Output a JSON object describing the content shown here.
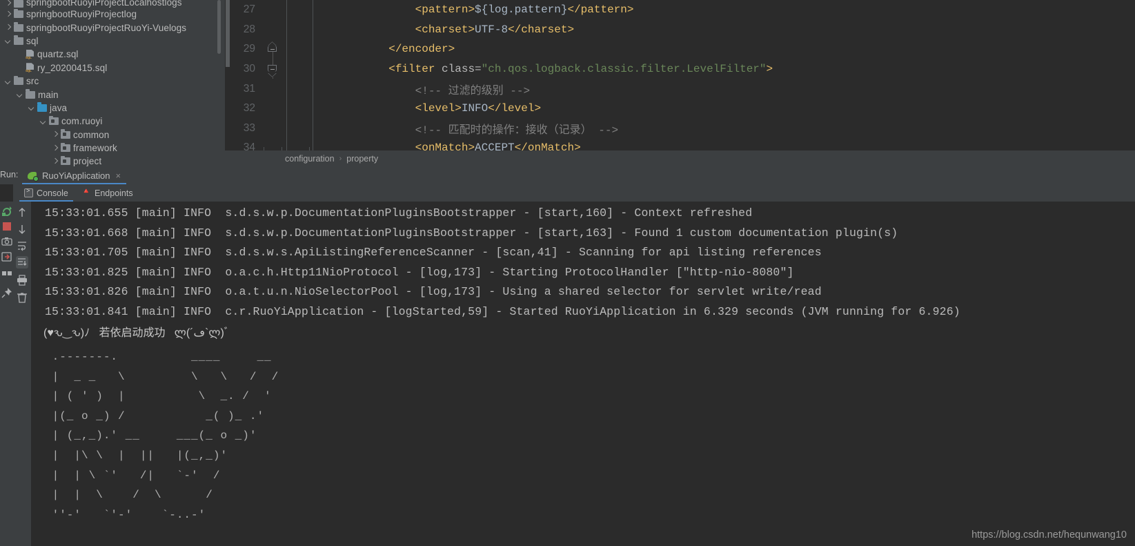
{
  "app": {
    "theme_bg": "#2b2b2b",
    "panel_bg": "#3c3f41",
    "accent": "#4a88c7",
    "text": "#bbbbbb"
  },
  "project_tree": {
    "items": [
      {
        "label": "springbootRuoyiProjectLocalhostlogs",
        "indent": 0,
        "arrow": "right",
        "icon": "folder-icon",
        "partial": true
      },
      {
        "label": "springbootRuoyiProjectlog",
        "indent": 0,
        "arrow": "right",
        "icon": "folder-icon"
      },
      {
        "label": "springbootRuoyiProjectRuoYi-Vuelogs",
        "indent": 0,
        "arrow": "right",
        "icon": "folder-icon"
      },
      {
        "label": "sql",
        "indent": 0,
        "arrow": "down",
        "icon": "folder-icon"
      },
      {
        "label": "quartz.sql",
        "indent": 1,
        "arrow": "none",
        "icon": "sql-file-icon"
      },
      {
        "label": "ry_20200415.sql",
        "indent": 1,
        "arrow": "none",
        "icon": "sql-file-icon"
      },
      {
        "label": "src",
        "indent": 0,
        "arrow": "down",
        "icon": "folder-icon"
      },
      {
        "label": "main",
        "indent": 1,
        "arrow": "down",
        "icon": "folder-icon"
      },
      {
        "label": "java",
        "indent": 2,
        "arrow": "down",
        "icon": "source-folder-icon"
      },
      {
        "label": "com.ruoyi",
        "indent": 3,
        "arrow": "down",
        "icon": "package-icon"
      },
      {
        "label": "common",
        "indent": 4,
        "arrow": "right",
        "icon": "package-icon"
      },
      {
        "label": "framework",
        "indent": 4,
        "arrow": "right",
        "icon": "package-icon"
      },
      {
        "label": "project",
        "indent": 4,
        "arrow": "right",
        "icon": "package-icon"
      }
    ]
  },
  "editor": {
    "lines": [
      {
        "num": "27",
        "fold": "none",
        "segments": [
          {
            "t": "                ",
            "c": "txt"
          },
          {
            "t": "<pattern>",
            "c": "tag"
          },
          {
            "t": "${log.pattern}",
            "c": "txt"
          },
          {
            "t": "</pattern>",
            "c": "tag"
          }
        ]
      },
      {
        "num": "28",
        "fold": "none",
        "segments": [
          {
            "t": "                ",
            "c": "txt"
          },
          {
            "t": "<charset>",
            "c": "tag"
          },
          {
            "t": "UTF-8",
            "c": "txt"
          },
          {
            "t": "</charset>",
            "c": "tag"
          }
        ]
      },
      {
        "num": "29",
        "fold": "up",
        "segments": [
          {
            "t": "            ",
            "c": "txt"
          },
          {
            "t": "</encoder>",
            "c": "tag"
          }
        ]
      },
      {
        "num": "30",
        "fold": "down",
        "segments": [
          {
            "t": "            ",
            "c": "txt"
          },
          {
            "t": "<filter ",
            "c": "tag"
          },
          {
            "t": "class=",
            "c": "attr"
          },
          {
            "t": "\"ch.qos.logback.classic.filter.LevelFilter\"",
            "c": "str"
          },
          {
            "t": ">",
            "c": "tag"
          }
        ]
      },
      {
        "num": "31",
        "fold": "none",
        "segments": [
          {
            "t": "                ",
            "c": "txt"
          },
          {
            "t": "<!-- 过滤的级别 -->",
            "c": "cmt"
          }
        ]
      },
      {
        "num": "32",
        "fold": "none",
        "segments": [
          {
            "t": "                ",
            "c": "txt"
          },
          {
            "t": "<level>",
            "c": "tag"
          },
          {
            "t": "INFO",
            "c": "txt"
          },
          {
            "t": "</level>",
            "c": "tag"
          }
        ]
      },
      {
        "num": "33",
        "fold": "none",
        "segments": [
          {
            "t": "                ",
            "c": "txt"
          },
          {
            "t": "<!-- 匹配时的操作：接收（记录） -->",
            "c": "cmt"
          }
        ]
      },
      {
        "num": "34",
        "fold": "none",
        "segments": [
          {
            "t": "                ",
            "c": "txt"
          },
          {
            "t": "<onMatch>",
            "c": "tag"
          },
          {
            "t": "ACCEPT",
            "c": "txt"
          },
          {
            "t": "</onMatch>",
            "c": "tag"
          }
        ]
      }
    ],
    "breadcrumb": [
      "configuration",
      "property"
    ],
    "breadcrumb_separator": "›"
  },
  "run_panel": {
    "run_label": "Run:",
    "tab_name": "RuoYiApplication",
    "tab_icon": "spring-boot-run-icon",
    "tab_close": "×",
    "sub_tabs": [
      {
        "label": "Console",
        "icon": "console-icon",
        "active": true
      },
      {
        "label": "Endpoints",
        "icon": "endpoints-icon",
        "active": false
      }
    ],
    "left_strip_icons": [
      "rerun-icon",
      "stop-icon",
      "camera-icon",
      "export-icon",
      "layout-icon",
      "pin-icon"
    ],
    "toolbar_icons": [
      {
        "name": "up-arrow-icon",
        "selected": false
      },
      {
        "name": "down-arrow-icon",
        "selected": false
      },
      {
        "name": "soft-wrap-icon",
        "selected": false
      },
      {
        "name": "scroll-to-end-icon",
        "selected": true
      },
      {
        "name": "print-icon",
        "selected": false
      },
      {
        "name": "trash-icon",
        "selected": false
      }
    ]
  },
  "console": {
    "log_lines": [
      "15:33:01.655 [main] INFO  s.d.s.w.p.DocumentationPluginsBootstrapper - [start,160] - Context refreshed",
      "15:33:01.668 [main] INFO  s.d.s.w.p.DocumentationPluginsBootstrapper - [start,163] - Found 1 custom documentation plugin(s)",
      "15:33:01.705 [main] INFO  s.d.s.w.s.ApiListingReferenceScanner - [scan,41] - Scanning for api listing references",
      "15:33:01.825 [main] INFO  o.a.c.h.Http11NioProtocol - [log,173] - Starting ProtocolHandler [\"http-nio-8080\"]",
      "15:33:01.826 [main] INFO  o.a.t.u.n.NioSelectorPool - [log,173] - Using a shared selector for servlet write/read",
      "15:33:01.841 [main] INFO  c.r.RuoYiApplication - [logStarted,59] - Started RuoYiApplication in 6.329 seconds (JVM running for 6.926)"
    ],
    "banner_success": "(♥ԅ‿ԅ)ﾉ   若依启动成功   ლ(´ڡ`ლ)ﾞ",
    "ascii_art": [
      " .-------.          ____     __",
      " |  _ _   \\         \\   \\   /  /",
      " | ( ' )  |          \\  _. /  '",
      " |(_ o _) /           _( )_ .'",
      " | (_,_).' __     ___(_ o _)'",
      " |  |\\ \\  |  ||   |(_,_)'",
      " |  | \\ `'   /|   `-'  /",
      " |  |  \\    /  \\      /",
      " ''-'   `'-'    `-..-'"
    ]
  },
  "watermark": {
    "text": "https://blog.csdn.net/hequnwang10"
  }
}
